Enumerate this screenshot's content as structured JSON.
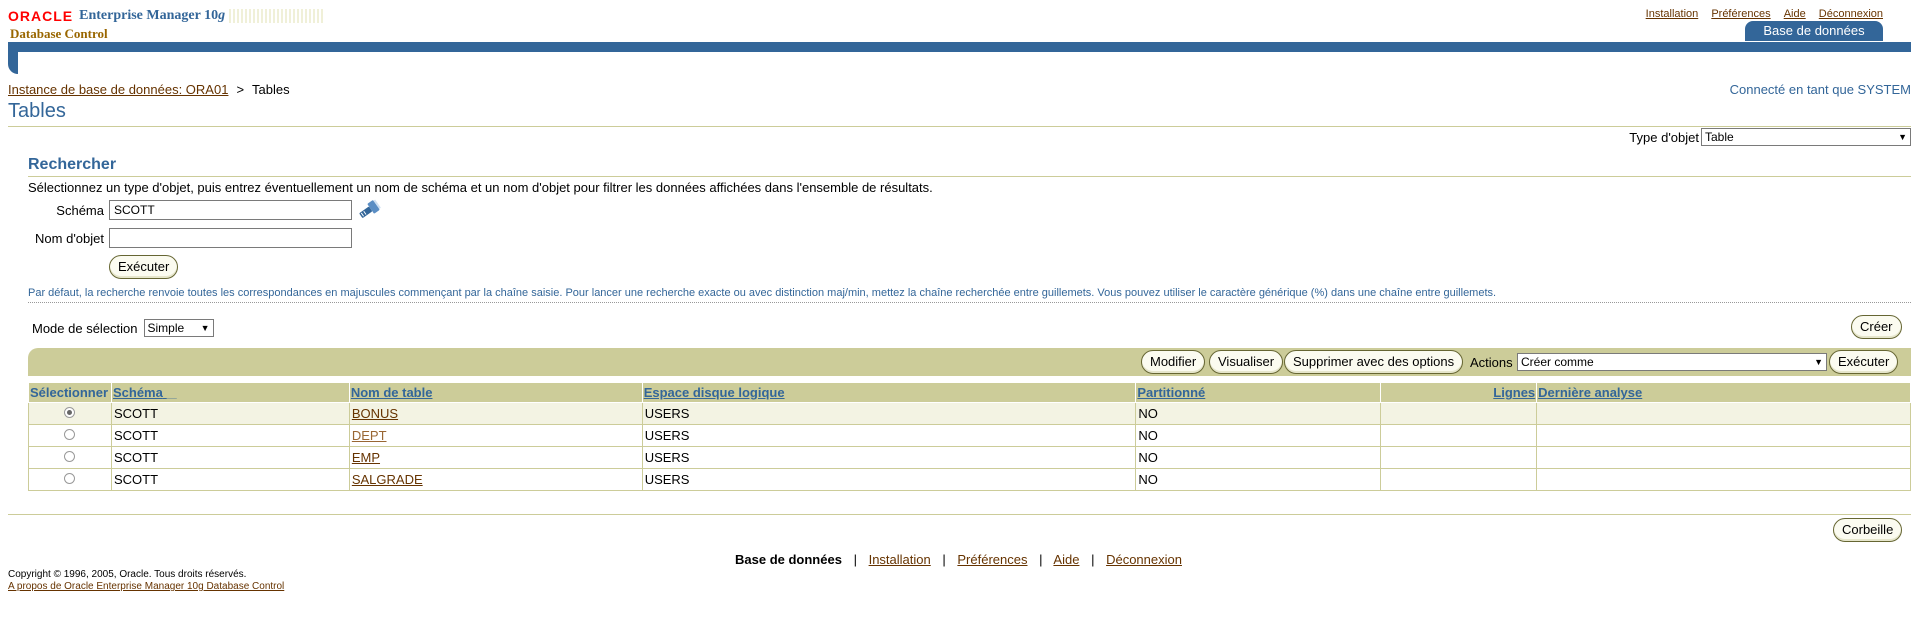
{
  "header": {
    "oracle": "ORACLE",
    "em_title": "Enterprise Manager 10",
    "em_g": "g",
    "subtitle": "Database Control",
    "global_links": [
      "Installation",
      "Préférences",
      "Aide",
      "Déconnexion"
    ],
    "tab": "Base de données"
  },
  "breadcrumb": {
    "parent": "Instance de base de données: ORA01",
    "separator": ">",
    "current": "Tables"
  },
  "connected_as": "Connecté en tant que SYSTEM",
  "page_title": "Tables",
  "object_type": {
    "label": "Type d'objet",
    "value": "Table"
  },
  "search": {
    "title": "Rechercher",
    "instructions": "Sélectionnez un type d'objet, puis entrez éventuellement un nom de schéma et un nom d'objet pour filtrer les données affichées dans l'ensemble de résultats.",
    "schema_label": "Schéma",
    "schema_value": "SCOTT",
    "object_name_label": "Nom d'objet",
    "object_name_value": "",
    "execute": "Exécuter",
    "tip": "Par défaut, la recherche renvoie toutes les correspondances en majuscules commençant par la chaîne saisie. Pour lancer une recherche exacte ou avec distinction maj/min, mettez la chaîne recherchée entre guillemets. Vous pouvez utiliser le caractère générique (%) dans une chaîne entre guillemets."
  },
  "selection_mode": {
    "label": "Mode de sélection",
    "value": "Simple"
  },
  "create_button": "Créer",
  "actions": {
    "modify": "Modifier",
    "view": "Visualiser",
    "delete_options": "Supprimer avec des options",
    "label": "Actions",
    "selected": "Créer comme",
    "execute": "Exécuter"
  },
  "table": {
    "headers": {
      "select": "Sélectionner",
      "schema": "Schéma",
      "sort_indicator": "△",
      "table_name": "Nom de table",
      "tablespace": "Espace disque logique",
      "partitioned": "Partitionné",
      "rows": "Lignes",
      "last_analyzed": "Dernière analyse"
    },
    "rows": [
      {
        "schema": "SCOTT",
        "name": "BONUS",
        "tablespace": "USERS",
        "partitioned": "NO",
        "rows": "",
        "last_analyzed": "",
        "selected": true
      },
      {
        "schema": "SCOTT",
        "name": "DEPT",
        "tablespace": "USERS",
        "partitioned": "NO",
        "rows": "",
        "last_analyzed": "",
        "selected": false
      },
      {
        "schema": "SCOTT",
        "name": "EMP",
        "tablespace": "USERS",
        "partitioned": "NO",
        "rows": "",
        "last_analyzed": "",
        "selected": false
      },
      {
        "schema": "SCOTT",
        "name": "SALGRADE",
        "tablespace": "USERS",
        "partitioned": "NO",
        "rows": "",
        "last_analyzed": "",
        "selected": false
      }
    ]
  },
  "recycle_bin": "Corbeille",
  "footer": {
    "current": "Base de données",
    "links": [
      "Installation",
      "Préférences",
      "Aide",
      "Déconnexion"
    ],
    "separator": "|",
    "copyright": "Copyright © 1996, 2005, Oracle. Tous droits réservés.",
    "about": "A propos de Oracle Enterprise Manager 10g Database Control"
  },
  "colors": {
    "brand_blue": "#336699",
    "link_brown": "#663300",
    "tan": "#cccc99",
    "oracle_red": "#ff0000"
  }
}
